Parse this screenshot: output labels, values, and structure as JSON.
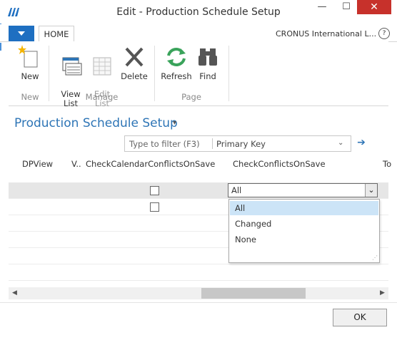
{
  "window": {
    "title": "Edit - Production Schedule Setup",
    "minimize_glyph": "—",
    "maximize_glyph": "☐",
    "close_glyph": "✕"
  },
  "ribbon": {
    "file_menu_icon": "chevron-down-icon",
    "tabs": [
      {
        "label": "HOME"
      }
    ],
    "company": "CRONUS International L...",
    "help_glyph": "?",
    "buttons": [
      {
        "label": "New",
        "icon": "new-star-icon",
        "enabled": true
      },
      {
        "label": "View\nList",
        "icon": "view-list-icon",
        "enabled": true
      },
      {
        "label": "Edit\nList",
        "icon": "edit-list-icon",
        "enabled": false
      },
      {
        "label": "Delete",
        "icon": "delete-x-icon",
        "enabled": true
      },
      {
        "label": "Refresh",
        "icon": "refresh-icon",
        "enabled": true
      },
      {
        "label": "Find",
        "icon": "binoculars-icon",
        "enabled": true
      }
    ],
    "groups": [
      {
        "label": "New"
      },
      {
        "label": "Manage"
      },
      {
        "label": "Page"
      }
    ]
  },
  "page": {
    "title": "Production Schedule Setup",
    "title_chevron": "▾"
  },
  "filter": {
    "placeholder": "Type to filter (F3)",
    "field": "Primary Key",
    "chevron": "⌄",
    "go_glyph": "➔"
  },
  "grid": {
    "columns": [
      {
        "label": "DPView"
      },
      {
        "label": "V.."
      },
      {
        "label": "CheckCalendarConflictsOnSave"
      },
      {
        "label": "CheckConflictsOnSave"
      },
      {
        "label": "To"
      }
    ],
    "rows": [
      {
        "check_calendar_conflicts": false,
        "check_conflicts": "All"
      },
      {
        "check_calendar_conflicts": false,
        "check_conflicts": ""
      }
    ]
  },
  "dropdown": {
    "selected": "All",
    "arrow": "⌄",
    "options": [
      {
        "label": "All"
      },
      {
        "label": "Changed"
      },
      {
        "label": "None"
      }
    ]
  },
  "scrollbar": {
    "left_glyph": "◀",
    "right_glyph": "▶"
  },
  "footer": {
    "ok_label": "OK"
  },
  "colors": {
    "accent": "#2e75b6",
    "file_menu": "#1e6fc1",
    "close": "#c7312b",
    "selection": "#cce4f7"
  }
}
